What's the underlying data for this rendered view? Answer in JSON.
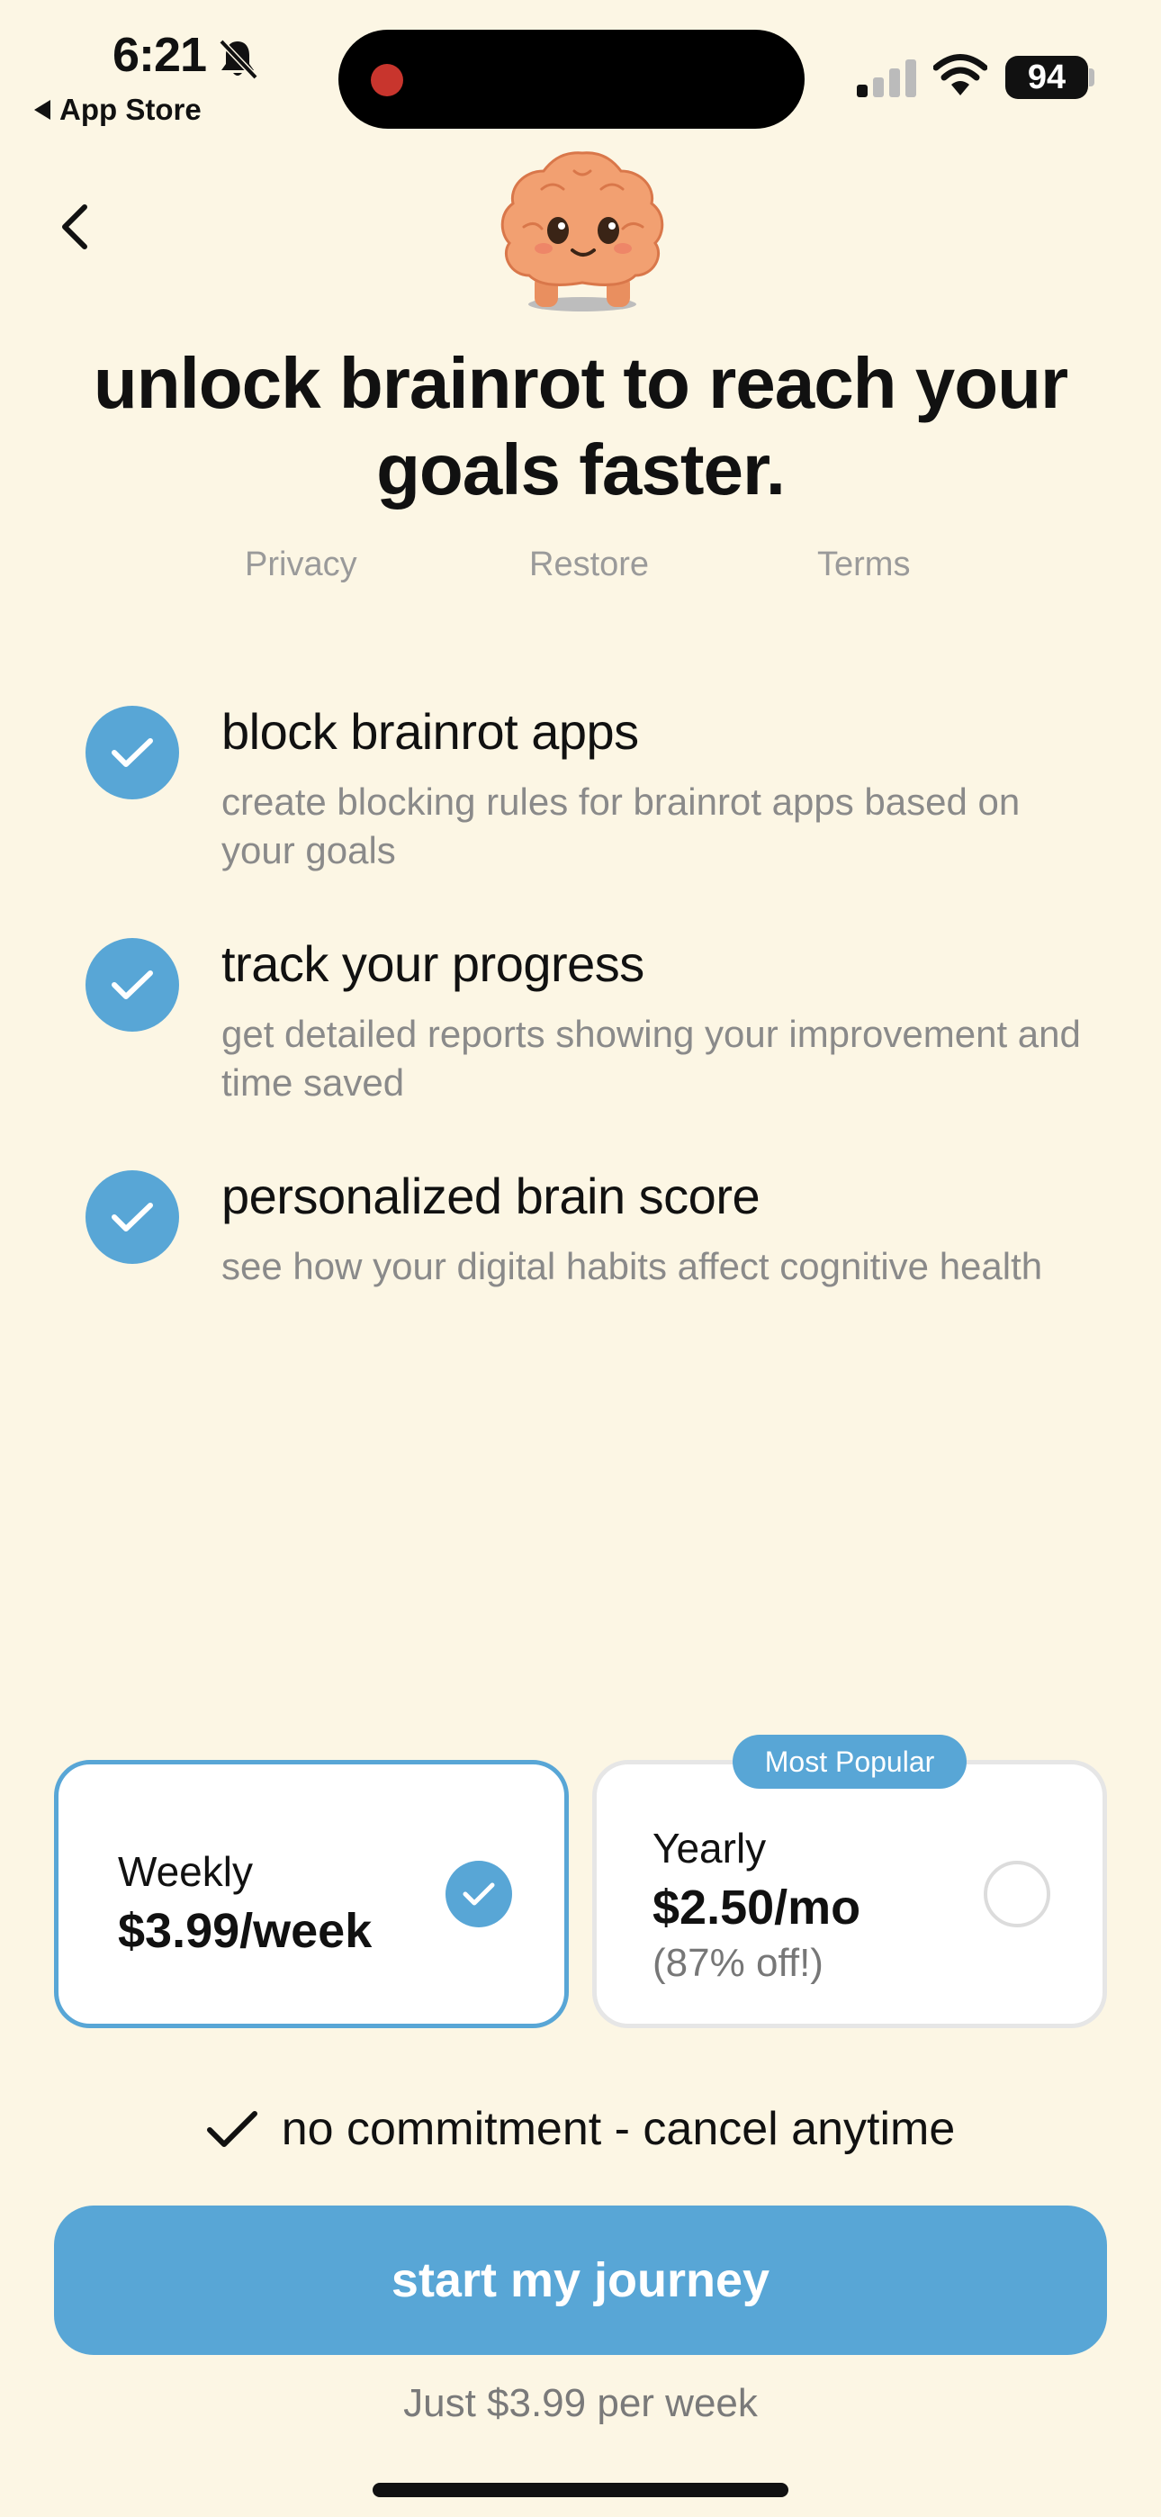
{
  "status_bar": {
    "time": "6:21",
    "back_app": "App Store",
    "battery": "94",
    "icons": [
      "bell-slash-icon",
      "signal-icon",
      "wifi-icon",
      "battery-icon"
    ]
  },
  "header": {
    "headline": "unlock brainrot to reach your goals faster.",
    "links": {
      "privacy": "Privacy",
      "restore": "Restore",
      "terms": "Terms"
    }
  },
  "features": [
    {
      "title": "block brainrot apps",
      "desc": "create blocking rules for brainrot apps based on your goals"
    },
    {
      "title": "track your progress",
      "desc": "get detailed reports showing your improvement and time saved"
    },
    {
      "title": "personalized brain score",
      "desc": "see how your digital habits affect cognitive health"
    }
  ],
  "plans": {
    "weekly": {
      "name": "Weekly",
      "price": "$3.99/week",
      "selected": true
    },
    "yearly": {
      "name": "Yearly",
      "price": "$2.50/mo",
      "note": "(87% off!)",
      "badge": "Most Popular",
      "selected": false
    }
  },
  "commitment": "no commitment - cancel anytime",
  "cta": {
    "label": "start my journey",
    "sub": "Just $3.99 per week"
  },
  "colors": {
    "background": "#fcf6e4",
    "accent": "#58a6d6",
    "text": "#111111",
    "muted": "#8a8a8a"
  }
}
